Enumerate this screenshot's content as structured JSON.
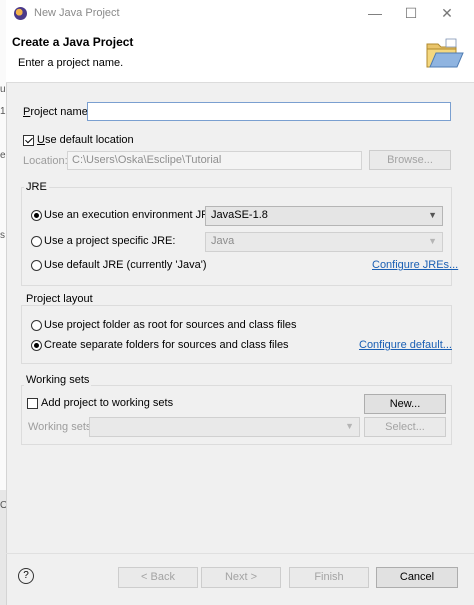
{
  "window": {
    "title": "New Java Project"
  },
  "header": {
    "title": "Create a Java Project",
    "message": "Enter a project name."
  },
  "project_name": {
    "label_prefix": "P",
    "label_rest": "roject name:",
    "value": ""
  },
  "use_default_location": {
    "label_prefix": "U",
    "label_rest": "se default location",
    "checked": true
  },
  "location": {
    "label": "Location:",
    "value": "C:\\Users\\Oska\\Esclipe\\Tutorial",
    "browse": "Browse..."
  },
  "jre": {
    "title": "JRE",
    "exec_env_label": "Use an execution environment JRE:",
    "exec_env_value": "JavaSE-1.8",
    "specific_label": "Use a project specific JRE:",
    "specific_value": "Java",
    "default_label": "Use default JRE (currently 'Java')",
    "configure_link": "Configure JREs..."
  },
  "layout": {
    "title": "Project layout",
    "root_label": "Use project folder as root for sources and class files",
    "separate_label": "Create separate folders for sources and class files",
    "configure_link": "Configure default..."
  },
  "working_sets": {
    "title": "Working sets",
    "add_label": "Add project to working sets",
    "new_button": "New...",
    "sets_label": "Working sets:",
    "select_button": "Select..."
  },
  "footer": {
    "back": "< Back",
    "next": "Next >",
    "finish": "Finish",
    "cancel": "Cancel",
    "help": "?"
  },
  "background_marks": [
    "u",
    "1",
    "s",
    "e",
    "Oc"
  ],
  "colors": {
    "link": "#1a5fb4",
    "focus_border": "#7a9fd0"
  }
}
